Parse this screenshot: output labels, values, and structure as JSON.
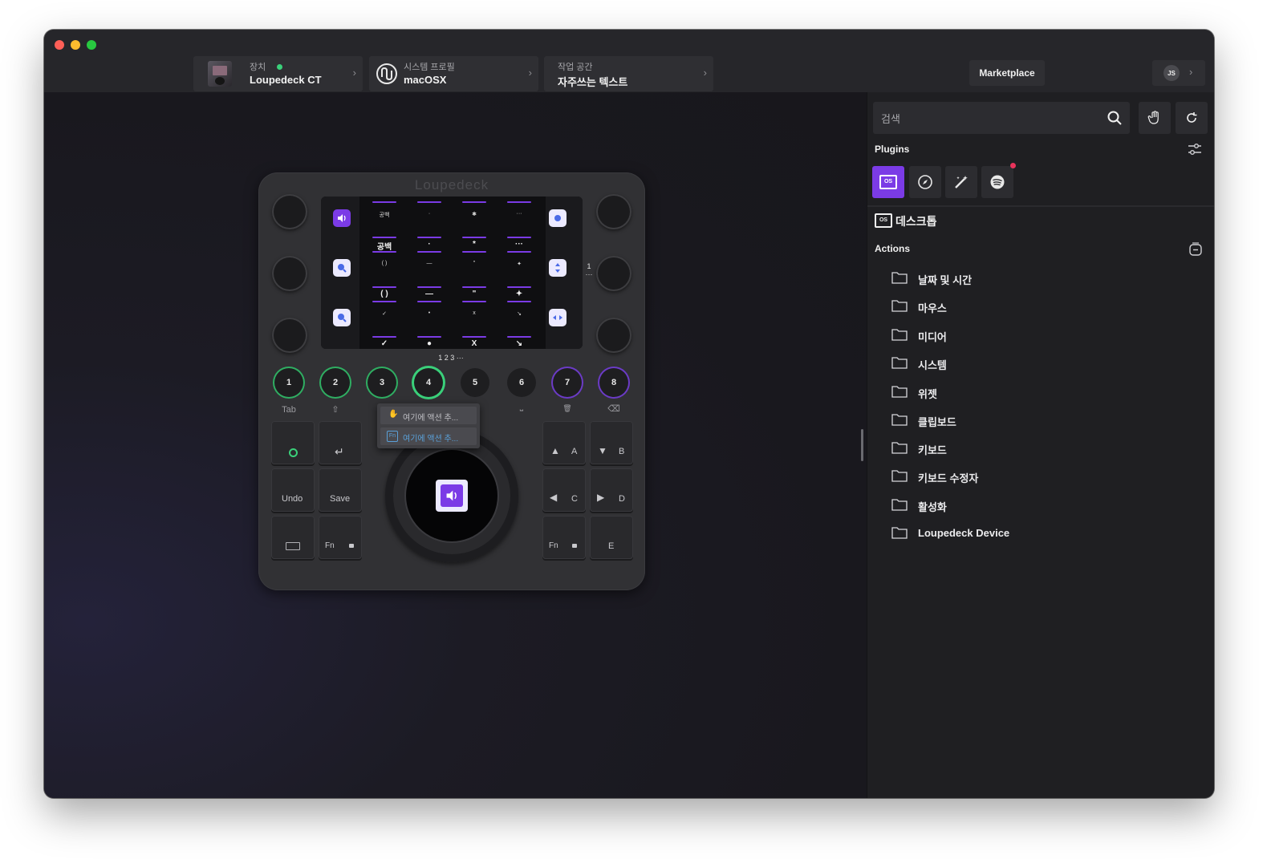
{
  "window": {
    "controls": [
      "close",
      "minimize",
      "zoom"
    ]
  },
  "header": {
    "device": {
      "label": "장치",
      "value": "Loupedeck CT"
    },
    "profile": {
      "label": "시스템 프로필",
      "value": "macOSX"
    },
    "workspace": {
      "label": "작업 공간",
      "value": "자주쓰는 텍스트"
    },
    "marketplace": "Marketplace",
    "user_initials": "JS"
  },
  "device": {
    "logo": "Loupedeck",
    "grid_labels": [
      [
        "공백",
        "·",
        "*",
        "···"
      ],
      [
        "( )",
        "—",
        "\"",
        "✦"
      ],
      [
        "✓",
        "●",
        "X",
        "↘"
      ]
    ],
    "grid_glyphs": [
      [
        "공백",
        "·",
        "✱",
        "···"
      ],
      [
        "( )",
        "—",
        "\"",
        "✦"
      ],
      [
        "✓",
        "•",
        "x",
        "↘"
      ]
    ],
    "page_indicator": "1 2 3 ···",
    "side_indicator": "1 ···",
    "number_buttons": [
      "1",
      "2",
      "3",
      "4",
      "5",
      "6",
      "7",
      "8"
    ],
    "number_labels": [
      "Tab",
      "⇧",
      "",
      "",
      "",
      "⎵",
      "🗑",
      "⌫"
    ],
    "left_keys": {
      "undo": "Undo",
      "save": "Save",
      "fn": "Fn"
    },
    "right_keys": {
      "a": "A",
      "b": "B",
      "c": "C",
      "d": "D",
      "fn": "Fn",
      "e": "E"
    },
    "popup": {
      "row1": "여기에 액션 추...",
      "row2": "여기에 액션 추..."
    }
  },
  "panel": {
    "search_placeholder": "검색",
    "plugins_title": "Plugins",
    "plugin_icons": [
      "desktop-os-icon",
      "compass-icon",
      "magic-wand-icon",
      "spotify-icon"
    ],
    "category_title": "데스크톱",
    "actions_title": "Actions",
    "folders": [
      "날짜 및 시간",
      "마우스",
      "미디어",
      "시스템",
      "위젯",
      "클립보드",
      "키보드",
      "키보드 수정자",
      "활성화",
      "Loupedeck Device"
    ]
  },
  "colors": {
    "accent_purple": "#7b3be6",
    "status_green": "#3ad07a",
    "badge_red": "#e8335b"
  }
}
